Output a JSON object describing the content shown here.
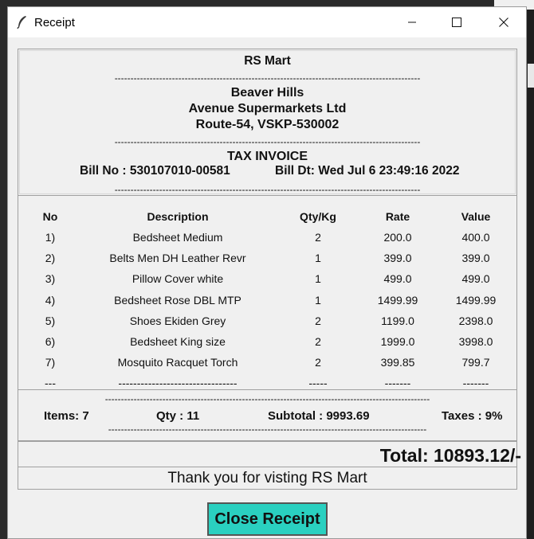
{
  "window": {
    "title": "Receipt"
  },
  "header": {
    "store": "RS Mart",
    "line1": "Beaver Hills",
    "line2": "Avenue Supermarkets Ltd",
    "line3": "Route-54, VSKP-530002",
    "invoice_title": "TAX INVOICE",
    "bill_no": "Bill No : 530107010-00581",
    "bill_dt": "Bill Dt: Wed Jul  6 23:49:16 2022",
    "dash_line": "------------------------------------------------------------------------------------------------"
  },
  "table": {
    "headers": {
      "no": "No",
      "desc": "Description",
      "qty": "Qty/Kg",
      "rate": "Rate",
      "value": "Value"
    },
    "rows": [
      {
        "no": "1)",
        "desc": "Bedsheet Medium",
        "qty": "2",
        "rate": "200.0",
        "value": "400.0"
      },
      {
        "no": "2)",
        "desc": "Belts Men DH Leather Revr",
        "qty": "1",
        "rate": "399.0",
        "value": "399.0"
      },
      {
        "no": "3)",
        "desc": "Pillow Cover white",
        "qty": "1",
        "rate": "499.0",
        "value": "499.0"
      },
      {
        "no": "4)",
        "desc": "Bedsheet Rose DBL MTP",
        "qty": "1",
        "rate": "1499.99",
        "value": "1499.99"
      },
      {
        "no": "5)",
        "desc": "Shoes Ekiden Grey",
        "qty": "2",
        "rate": "1199.0",
        "value": "2398.0"
      },
      {
        "no": "6)",
        "desc": "Bedsheet King size",
        "qty": "2",
        "rate": "1999.0",
        "value": "3998.0"
      },
      {
        "no": "7)",
        "desc": "Mosquito Racquet Torch",
        "qty": "2",
        "rate": "399.85",
        "value": "799.7"
      }
    ],
    "end_row": {
      "no": "---",
      "desc": "--------------------------------",
      "qty": "-----",
      "rate": "-------",
      "value": "-------"
    }
  },
  "totals": {
    "dash_line": "------------------------------------------------------------------------------------------------------",
    "dash_line2": "----------------------------------------------------------------------------------------------------",
    "items": "Items: 7",
    "qty": "Qty : 11",
    "subtotal": "Subtotal : 9993.69",
    "taxes": "Taxes : 9%",
    "grand_total": "Total: 10893.12/-"
  },
  "footer": {
    "thanks": "Thank you for visting RS Mart",
    "close_label": "Close Receipt"
  },
  "colors": {
    "button_bg": "#2ad0c0",
    "window_bg": "#f0f0f0"
  }
}
